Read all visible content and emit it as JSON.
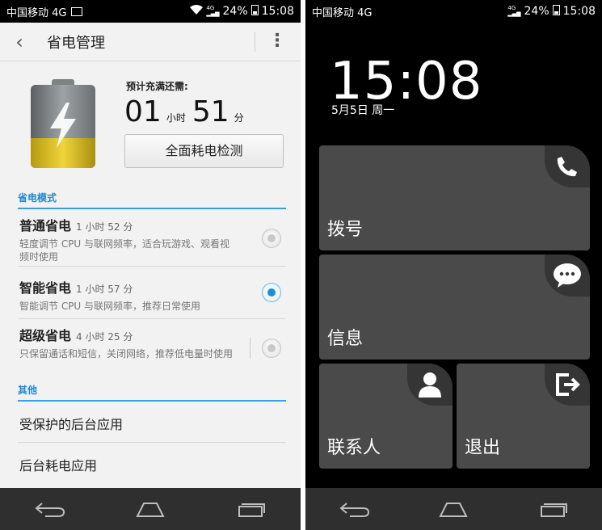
{
  "left_screen": {
    "status": {
      "carrier": "中国移动 4G",
      "battery": "24%",
      "time": "15:08"
    },
    "appbar": {
      "title": "省电管理"
    },
    "charge": {
      "eta_label": "预计充满还需:",
      "hours": "01",
      "hours_unit": "小时",
      "minutes": "51",
      "minutes_unit": "分",
      "battery_level": 0.24,
      "check_button": "全面耗电检测"
    },
    "mode_section": "省电模式",
    "modes": [
      {
        "title": "普通省电",
        "duration": "1 小时 52 分",
        "desc": "轻度调节 CPU 与联网频率，适合玩游戏、观看视频时使用",
        "selected": false
      },
      {
        "title": "智能省电",
        "duration": "1 小时 57 分",
        "desc": "智能调节 CPU 与联网频率，推荐日常使用",
        "selected": true
      },
      {
        "title": "超级省电",
        "duration": "4 小时 25 分",
        "desc": "只保留通话和短信，关闭网络，推荐低电量时使用",
        "selected": false
      }
    ],
    "other_section": "其他",
    "others": [
      "受保护的后台应用",
      "后台耗电应用"
    ]
  },
  "right_screen": {
    "status": {
      "carrier": "中国移动 4G",
      "battery": "24%",
      "time": "15:08"
    },
    "clock": "15:08",
    "date": "5月5日 周一",
    "tiles": {
      "dial": "拨号",
      "message": "信息",
      "contacts": "联系人",
      "exit": "退出"
    }
  },
  "colors": {
    "accent": "#1e8fd6",
    "tile": "#4a4a4a",
    "navbar": "#2f2f2f"
  },
  "icons": [
    "back-icon",
    "more-icon",
    "phone-icon",
    "chat-icon",
    "contact-icon",
    "exit-icon",
    "nav-back-icon",
    "nav-home-icon",
    "nav-recent-icon"
  ]
}
